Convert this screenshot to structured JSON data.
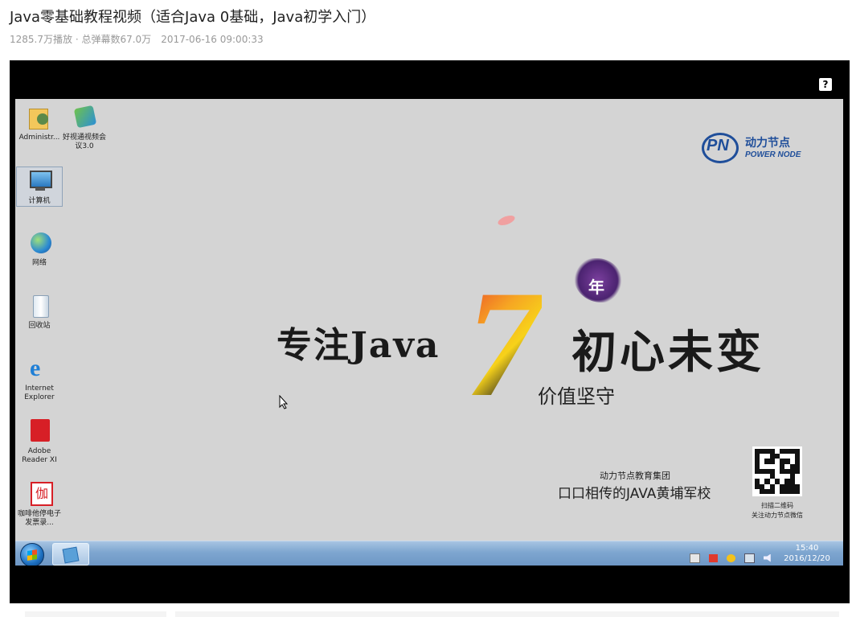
{
  "video": {
    "title": "Java零基础教程视频（适合Java 0基础，Java初学入门）",
    "play_count": "1285.7万播放",
    "separator": " · ",
    "danmaku_count": "总弹幕数67.0万",
    "publish_time": "2017-06-16 09:00:33"
  },
  "player": {
    "help_button": "?"
  },
  "desktop": {
    "icons": [
      {
        "label": "Administr...",
        "icon": "user-folder-icon"
      },
      {
        "label": "好视通视频会议3.0",
        "icon": "video-conference-icon"
      },
      {
        "label": "计算机",
        "icon": "computer-icon"
      },
      {
        "label": "网络",
        "icon": "network-icon"
      },
      {
        "label": "回收站",
        "icon": "recycle-bin-icon"
      },
      {
        "label": "Internet Explorer",
        "icon": "ie-icon"
      },
      {
        "label": "Adobe Reader XI",
        "icon": "adobe-reader-icon"
      },
      {
        "label": "咖啡他停电子发票录...",
        "icon": "app-shortcut-icon"
      }
    ],
    "wallpaper": {
      "logo_cn": "动力节点",
      "logo_en": "POWER NODE",
      "logo_mark": "PN",
      "big_number": "7",
      "year_char": "年",
      "slogan_left": "专注Java",
      "slogan_right": "初心未变",
      "sub_slogan": "价值坚守",
      "group_name": "动力节点教育集团",
      "tagline": "口口相传的JAVA黄埔军校",
      "qr_caption_1": "扫描二维码",
      "qr_caption_2": "关注动力节点微信"
    },
    "taskbar": {
      "time": "15:40",
      "date": "2016/12/20"
    }
  }
}
